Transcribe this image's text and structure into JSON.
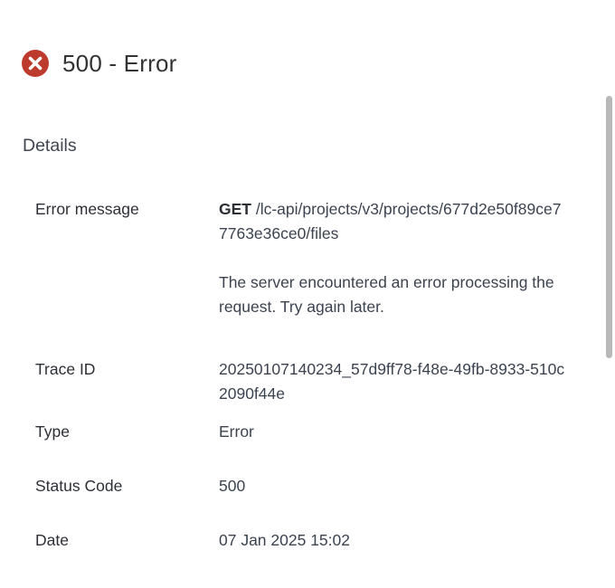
{
  "header": {
    "icon": "error-circle-icon",
    "title": "500 - Error",
    "icon_color": "#bd3b2d"
  },
  "details": {
    "section_title": "Details",
    "error_message": {
      "label": "Error message",
      "method": "GET",
      "path": "/lc-api/projects/v3/projects/677d2e50f89ce77763e36ce0/files",
      "text": "The server encountered an error processing the request. Try again later."
    },
    "trace_id": {
      "label": "Trace ID",
      "value": "20250107140234_57d9ff78-f48e-49fb-8933-510c2090f44e"
    },
    "type": {
      "label": "Type",
      "value": "Error",
      "value_color": "#b33a2e"
    },
    "status_code": {
      "label": "Status Code",
      "value": "500"
    },
    "date": {
      "label": "Date",
      "value": "07 Jan 2025 15:02"
    }
  }
}
